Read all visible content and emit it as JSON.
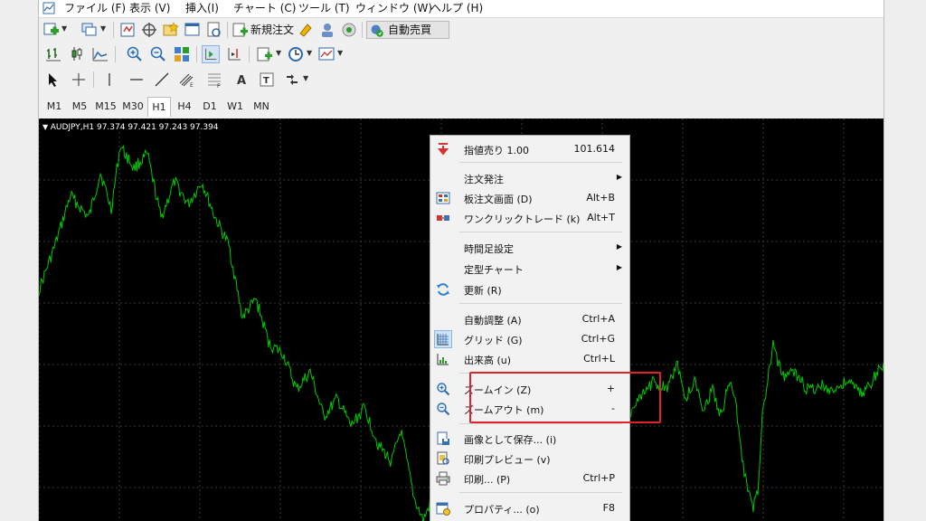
{
  "menubar": {
    "items": [
      "ファイル (F)",
      "表示 (V)",
      "挿入(I)",
      "チャート (C)",
      "ツール (T)",
      "ウィンドウ (W)",
      "ヘルプ (H)"
    ]
  },
  "toolbar": {
    "new_order_label": "新規注文",
    "auto_trade_label": "自動売買"
  },
  "timeframes": {
    "items": [
      "M1",
      "M5",
      "M15",
      "M30",
      "H1",
      "H4",
      "D1",
      "W1",
      "MN"
    ],
    "active": "H1"
  },
  "chart": {
    "title": "AUDJPY,H1  97.374 97.421 97.243 97.394",
    "line_color": "#00c800",
    "grid_color": "#3a3a3a"
  },
  "context_menu": {
    "items": [
      {
        "label": "指値売り 1.00",
        "shortcut": "101.614",
        "icon": "sell-arrow-icon"
      },
      {
        "label": "注文発注",
        "shortcut": "",
        "submenu": true
      },
      {
        "label": "板注文画面 (D)",
        "shortcut": "Alt+B",
        "icon": "order-board-icon"
      },
      {
        "label": "ワンクリックトレード (k)",
        "shortcut": "Alt+T",
        "icon": "one-click-trade-icon"
      },
      {
        "label": "時間足設定",
        "shortcut": "",
        "submenu": true
      },
      {
        "label": "定型チャート",
        "shortcut": "",
        "submenu": true
      },
      {
        "label": "更新 (R)",
        "shortcut": "",
        "icon": "refresh-icon"
      },
      {
        "label": "自動調整 (A)",
        "shortcut": "Ctrl+A"
      },
      {
        "label": "グリッド (G)",
        "shortcut": "Ctrl+G",
        "icon": "grid-icon",
        "checked": true
      },
      {
        "label": "出来高 (u)",
        "shortcut": "Ctrl+L",
        "icon": "volume-icon"
      },
      {
        "label": "ズームイン (Z)",
        "shortcut": "+",
        "icon": "zoom-in-icon"
      },
      {
        "label": "ズームアウト (m)",
        "shortcut": "-",
        "icon": "zoom-out-icon"
      },
      {
        "label": "画像として保存... (i)",
        "shortcut": "",
        "icon": "save-image-icon"
      },
      {
        "label": "印刷プレビュー (v)",
        "shortcut": "",
        "icon": "print-preview-icon"
      },
      {
        "label": "印刷... (P)",
        "shortcut": "Ctrl+P",
        "icon": "print-icon"
      },
      {
        "label": "プロパティ... (o)",
        "shortcut": "F8",
        "icon": "properties-icon"
      }
    ],
    "highlight_color": "#e0222b"
  }
}
